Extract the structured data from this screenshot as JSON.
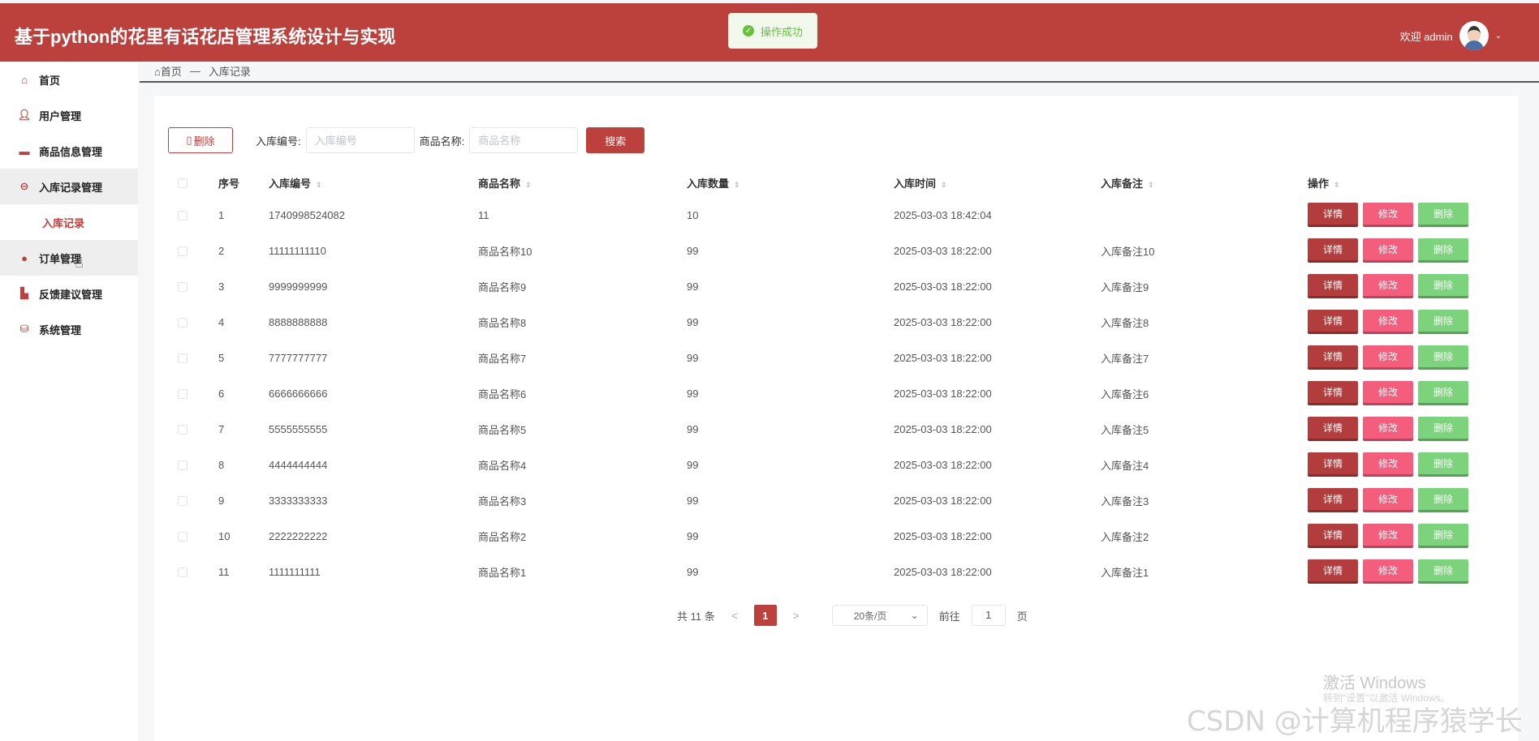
{
  "header": {
    "title": "基于python的花里有话花店管理系统设计与实现",
    "welcome": "欢迎 admin"
  },
  "toast": {
    "text": "操作成功"
  },
  "sidebar": {
    "items": [
      {
        "label": "首页",
        "icon": "home-icon"
      },
      {
        "label": "用户管理",
        "icon": "user-icon"
      },
      {
        "label": "商品信息管理",
        "icon": "box-icon"
      },
      {
        "label": "入库记录管理",
        "icon": "circle-icon"
      },
      {
        "label": "订单管理",
        "icon": "order-icon"
      },
      {
        "label": "反馈建议管理",
        "icon": "feedback-icon"
      },
      {
        "label": "系统管理",
        "icon": "system-icon"
      }
    ],
    "sub_item": "入库记录"
  },
  "breadcrumb": {
    "home": "首页",
    "sep": "—",
    "current": "入库记录"
  },
  "toolbar": {
    "delete_label": "删除",
    "code_label": "入库编号:",
    "code_placeholder": "入库编号",
    "name_label": "商品名称:",
    "name_placeholder": "商品名称",
    "search_label": "搜索"
  },
  "table": {
    "headers": [
      "序号",
      "入库编号",
      "商品名称",
      "入库数量",
      "入库时间",
      "入库备注",
      "操作"
    ],
    "rows": [
      [
        "1",
        "1740998524082",
        "11",
        "10",
        "2025-03-03 18:42:04",
        ""
      ],
      [
        "2",
        "11111111110",
        "商品名称10",
        "99",
        "2025-03-03 18:22:00",
        "入库备注10"
      ],
      [
        "3",
        "9999999999",
        "商品名称9",
        "99",
        "2025-03-03 18:22:00",
        "入库备注9"
      ],
      [
        "4",
        "8888888888",
        "商品名称8",
        "99",
        "2025-03-03 18:22:00",
        "入库备注8"
      ],
      [
        "5",
        "7777777777",
        "商品名称7",
        "99",
        "2025-03-03 18:22:00",
        "入库备注7"
      ],
      [
        "6",
        "6666666666",
        "商品名称6",
        "99",
        "2025-03-03 18:22:00",
        "入库备注6"
      ],
      [
        "7",
        "5555555555",
        "商品名称5",
        "99",
        "2025-03-03 18:22:00",
        "入库备注5"
      ],
      [
        "8",
        "4444444444",
        "商品名称4",
        "99",
        "2025-03-03 18:22:00",
        "入库备注4"
      ],
      [
        "9",
        "3333333333",
        "商品名称3",
        "99",
        "2025-03-03 18:22:00",
        "入库备注3"
      ],
      [
        "10",
        "2222222222",
        "商品名称2",
        "99",
        "2025-03-03 18:22:00",
        "入库备注2"
      ],
      [
        "11",
        "1111111111",
        "商品名称1",
        "99",
        "2025-03-03 18:22:00",
        "入库备注1"
      ]
    ],
    "actions": {
      "detail": "详情",
      "edit": "修改",
      "remove": "删除"
    }
  },
  "pager": {
    "total": "共 11 条",
    "prev": "<",
    "page": "1",
    "next": ">",
    "size": "20条/页",
    "goto_label": "前往",
    "goto_value": "1",
    "page_unit": "页"
  },
  "watermarks": {
    "line1": "激活 Windows",
    "line2": "转到\"设置\"以激活 Windows。",
    "line3": "CSDN @计算机程序猿学长"
  },
  "colors": {
    "brand": "#bc413d",
    "detail": "#b33d3d",
    "edit": "#f45e7c",
    "remove": "#7bd47b"
  }
}
